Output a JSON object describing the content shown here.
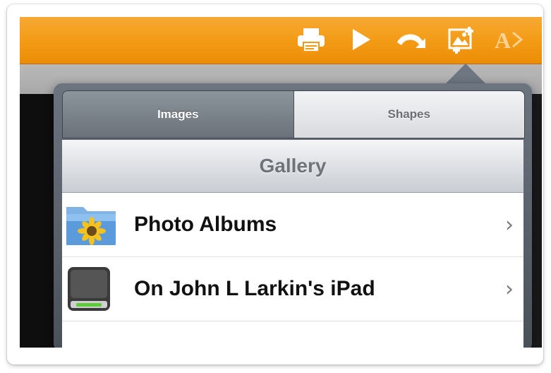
{
  "toolbar": {
    "background": "#f39a14",
    "icons": [
      "printer-icon",
      "play-icon",
      "undo-icon",
      "insert-image-icon",
      "text-format-icon"
    ]
  },
  "popover": {
    "tabs": [
      {
        "label": "Images",
        "active": true
      },
      {
        "label": "Shapes",
        "active": false
      }
    ],
    "header_title": "Gallery",
    "rows": [
      {
        "label": "Photo Albums",
        "icon": "photo-albums-folder-icon",
        "chevron": "›"
      },
      {
        "label": "On John L Larkin's iPad",
        "icon": "ipad-drive-icon",
        "chevron": "›"
      }
    ]
  }
}
